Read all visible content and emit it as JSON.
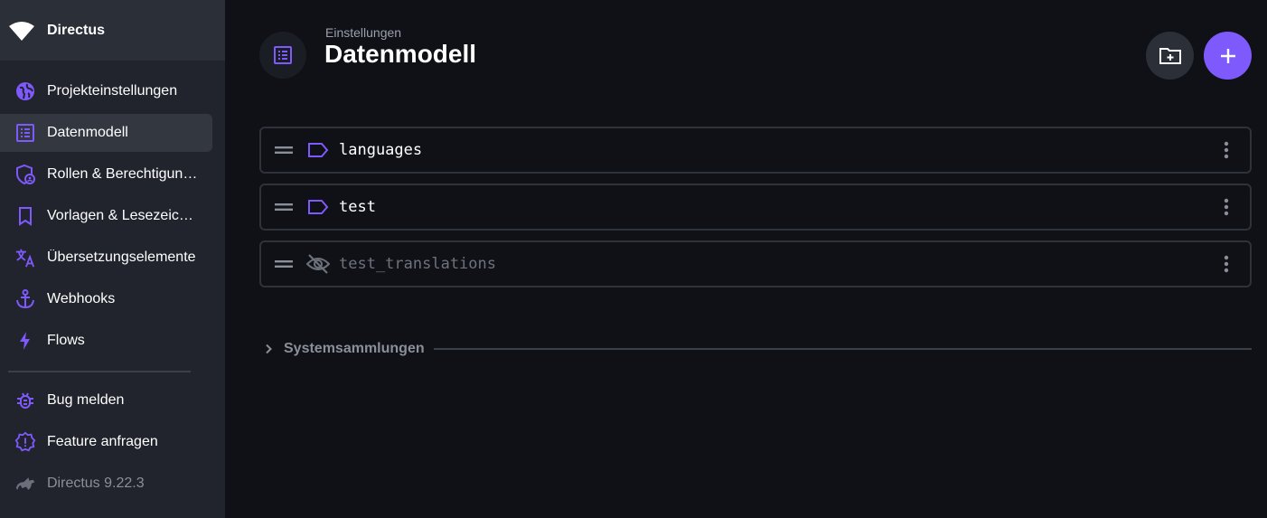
{
  "app": {
    "title": "Directus"
  },
  "colors": {
    "accent": "#7e59fb",
    "sidebar": "#21242c",
    "background": "#0f1116"
  },
  "sidebar": {
    "items": [
      {
        "label": "Projekteinstellungen",
        "icon": "globe-icon"
      },
      {
        "label": "Datenmodell",
        "icon": "list-alt-icon",
        "active": true
      },
      {
        "label": "Rollen & Berechtigungen",
        "icon": "admin-shield-icon"
      },
      {
        "label": "Vorlagen & Lesezeichen",
        "icon": "bookmark-icon"
      },
      {
        "label": "Übersetzungselemente",
        "icon": "translate-icon"
      },
      {
        "label": "Webhooks",
        "icon": "anchor-icon"
      },
      {
        "label": "Flows",
        "icon": "bolt-icon"
      }
    ],
    "bottom_items": [
      {
        "label": "Bug melden",
        "icon": "bug-icon"
      },
      {
        "label": "Feature anfragen",
        "icon": "new-releases-icon"
      },
      {
        "label": "Directus 9.22.3",
        "icon": "directus-rabbit-icon"
      }
    ]
  },
  "header": {
    "breadcrumb": "Einstellungen",
    "title": "Datenmodell"
  },
  "collections": [
    {
      "name": "languages",
      "icon": "label-icon",
      "hidden": false
    },
    {
      "name": "test",
      "icon": "label-icon",
      "hidden": false
    },
    {
      "name": "test_translations",
      "icon": "visibility-off-icon",
      "hidden": true
    }
  ],
  "system_collections": {
    "label": "Systemsammlungen"
  }
}
